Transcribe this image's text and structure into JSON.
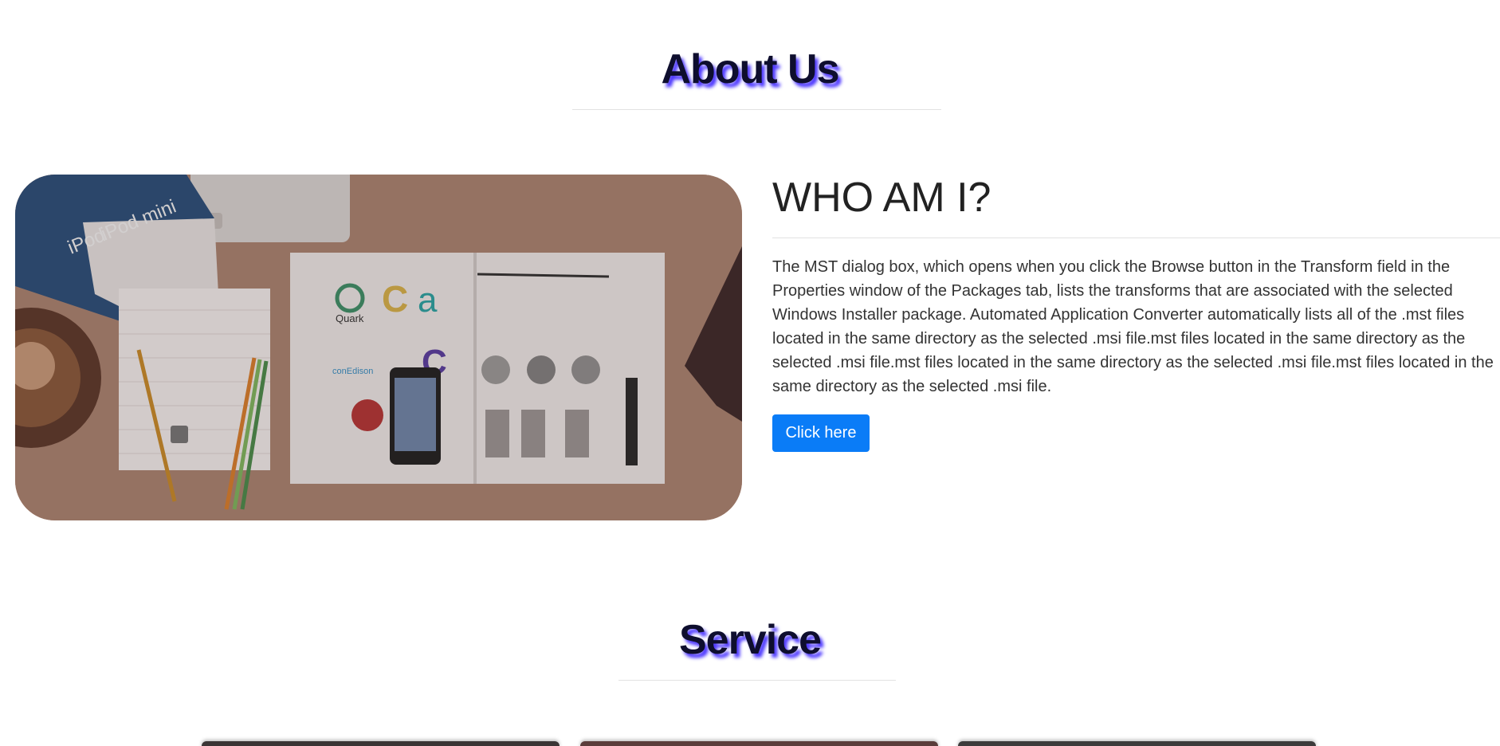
{
  "about": {
    "title": "About Us"
  },
  "hero_image": {
    "brand_words": [
      "iPod",
      "iPod mini",
      "Quark",
      "conEdison"
    ],
    "icon": "desk-workspace-photo"
  },
  "who": {
    "heading": "WHO AM I?",
    "paragraph": "The MST dialog box, which opens when you click the Browse button in the Transform field in the Properties window of the Packages tab, lists the transforms that are associated with the selected Windows Installer package. Automated Application Converter automatically lists all of the .mst files located in the same directory as the selected .msi file.mst files located in the same directory as the selected .msi file.mst files located in the same directory as the selected .msi file.mst files located in the same directory as the selected .msi file.",
    "button_label": "Click here"
  },
  "service": {
    "title": "Service",
    "cards": [
      {
        "name": "service-card-1"
      },
      {
        "name": "service-card-2"
      },
      {
        "name": "service-card-3"
      }
    ]
  },
  "colors": {
    "title_shadow": "#4b35ff",
    "button": "#0a7cf7",
    "divider": "#e2e2e2"
  }
}
